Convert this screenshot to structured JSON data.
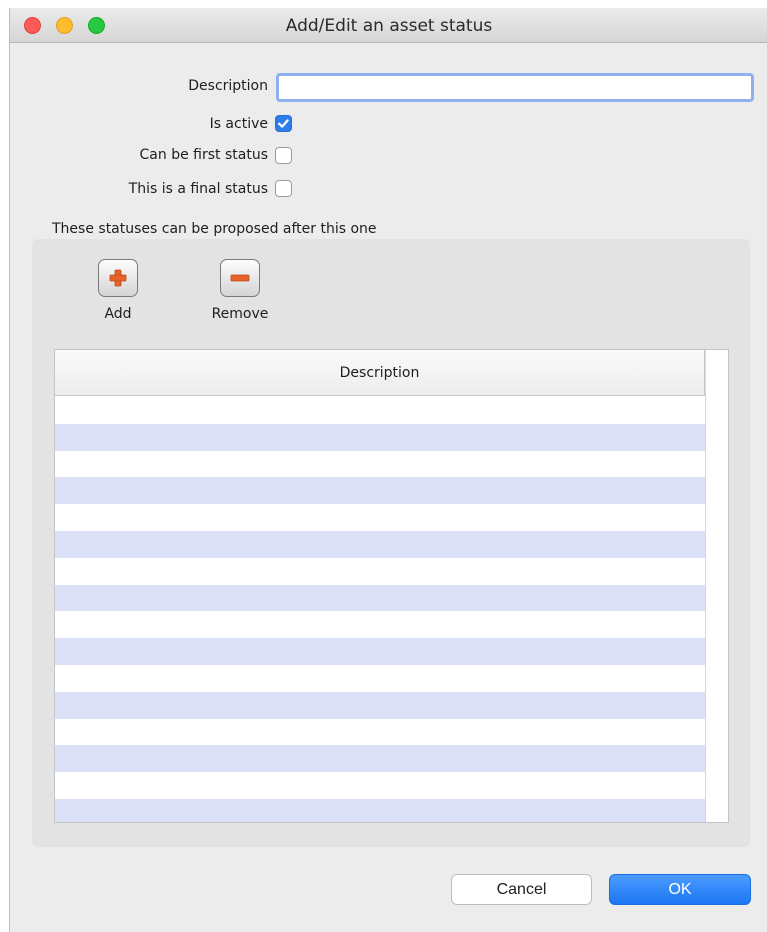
{
  "window": {
    "title": "Add/Edit an asset status"
  },
  "form": {
    "description_label": "Description",
    "description_value": "",
    "is_active_label": "Is active",
    "is_active_checked": true,
    "can_be_first_label": "Can be first status",
    "can_be_first_checked": false,
    "final_status_label": "This is a final status",
    "final_status_checked": false
  },
  "proposed": {
    "section_label": "These statuses can be proposed after this one",
    "add_label": "Add",
    "remove_label": "Remove",
    "table": {
      "columns": [
        "Description"
      ],
      "rows": []
    }
  },
  "buttons": {
    "cancel_label": "Cancel",
    "ok_label": "OK"
  },
  "colors": {
    "accent": "#2f7de9",
    "row_stripe": "#dde1f8",
    "add_icon": "#e8622a",
    "remove_icon": "#e8622a"
  },
  "icons": {
    "add": "plus-icon",
    "remove": "minus-icon",
    "checkmark": "checkmark-icon"
  }
}
